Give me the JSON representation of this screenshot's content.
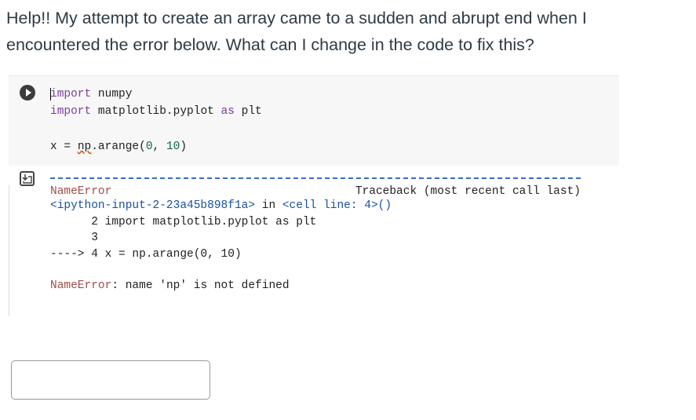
{
  "question": "Help!! My attempt to create an array came to a sudden and abrupt end when I encountered the error below. What can I change in the code to fix this?",
  "code": {
    "line1_kw": "import",
    "line1_rest": " numpy",
    "line2_kw": "import",
    "line2_mid": " matplotlib.pyplot ",
    "line2_as": "as",
    "line2_rest": " plt",
    "line3_pre": "x = ",
    "line3_np": "np",
    "line3_mid": ".arange(",
    "line3_n1": "0",
    "line3_comma": ", ",
    "line3_n2": "10",
    "line3_end": ")"
  },
  "output": {
    "error_name": "NameError",
    "traceback_label": "Traceback (most recent call last)",
    "input_ref": "<ipython-input-2-23a45b898f1a>",
    "in_text": " in ",
    "cell_ref": "<cell line: 4>()",
    "tb_line2": "      2 import matplotlib.pyplot as plt",
    "tb_line3": "      3",
    "tb_arrow": "----> 4 x = np.arange(0, 10)",
    "final_error_name": "NameError",
    "final_error_msg": ": name 'np' is not defined"
  },
  "answer": {
    "value": ""
  }
}
